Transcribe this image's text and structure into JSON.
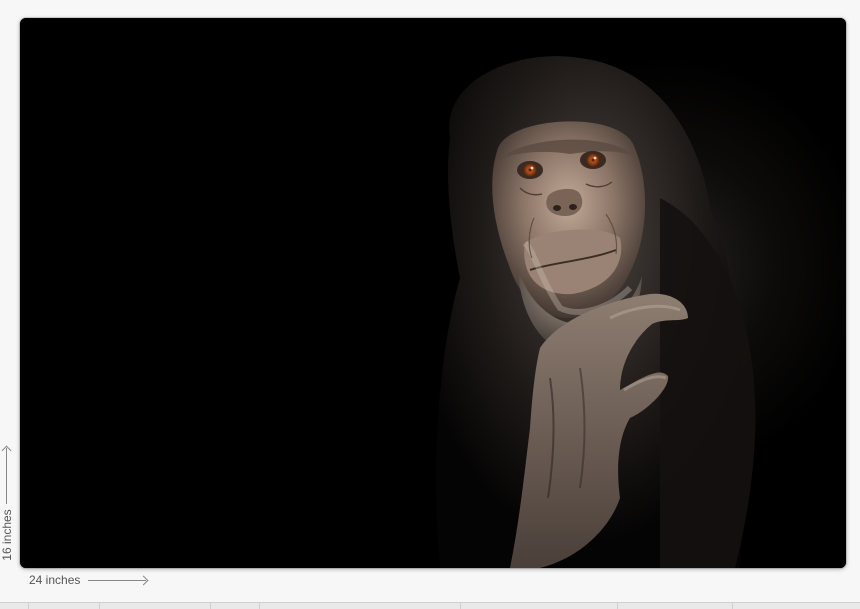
{
  "preview": {
    "image_subject": "chimpanzee-portrait",
    "width_label": "24 inches",
    "height_label": "16 inches",
    "background_color": "#000000"
  }
}
